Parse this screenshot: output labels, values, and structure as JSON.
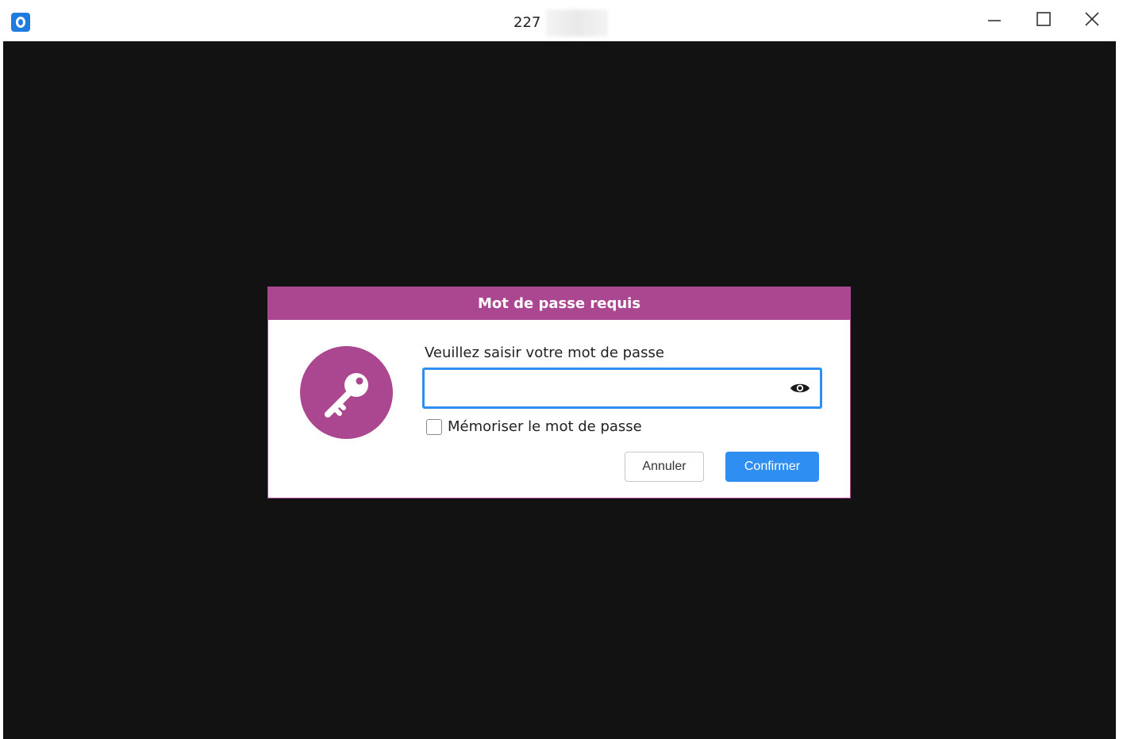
{
  "window": {
    "title": "227",
    "controls": {
      "minimize_icon": "minimize-icon",
      "maximize_icon": "maximize-icon",
      "close_icon": "close-icon"
    }
  },
  "dialog": {
    "title": "Mot de passe requis",
    "icon": "key-icon",
    "prompt": "Veuillez saisir votre mot de passe",
    "password": {
      "value": "",
      "placeholder": ""
    },
    "show_password_icon": "eye-icon",
    "remember": {
      "label": "Mémoriser le mot de passe",
      "checked": false
    },
    "buttons": {
      "cancel": "Annuler",
      "confirm": "Confirmer"
    }
  },
  "colors": {
    "accent": "#ab4790",
    "primary_button": "#2f8ef2",
    "background": "#121212"
  }
}
